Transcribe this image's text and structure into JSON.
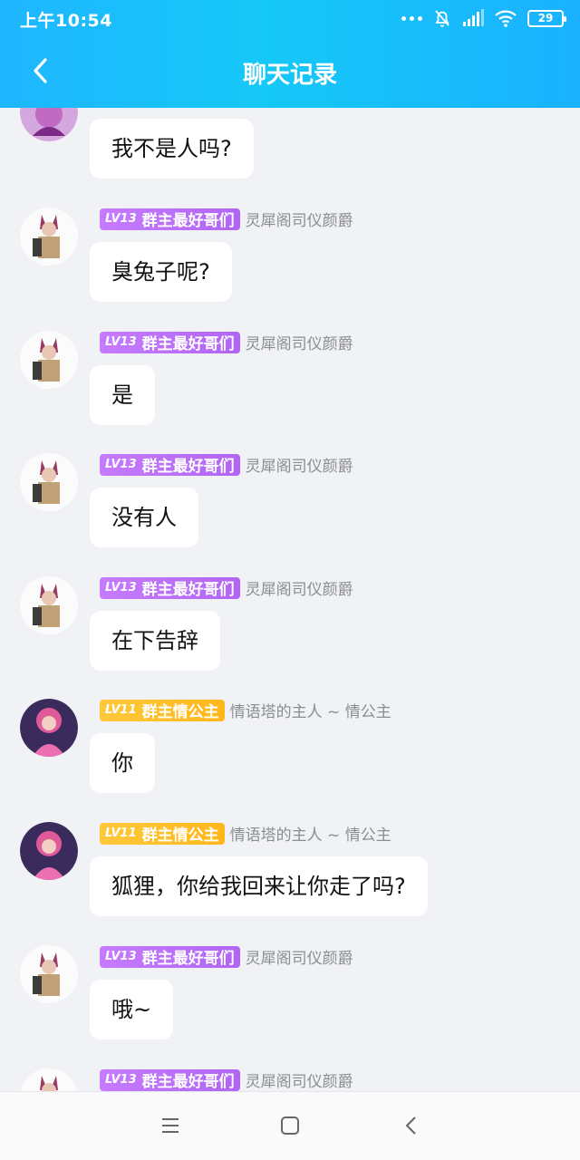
{
  "status_bar": {
    "time": "上午10:54",
    "battery": "29"
  },
  "header": {
    "title": "聊天记录"
  },
  "messages": [
    {
      "avatar": "fox-girl-avatar",
      "level": "",
      "title": "",
      "name": "",
      "text": "我不是人吗?"
    },
    {
      "avatar": "fox-girl-avatar",
      "level": "LV13",
      "title": "群主最好哥们",
      "name": "灵犀阁司仪颜爵",
      "text": "臭兔子呢?"
    },
    {
      "avatar": "fox-girl-avatar",
      "level": "LV13",
      "title": "群主最好哥们",
      "name": "灵犀阁司仪颜爵",
      "text": "是"
    },
    {
      "avatar": "fox-girl-avatar",
      "level": "LV13",
      "title": "群主最好哥们",
      "name": "灵犀阁司仪颜爵",
      "text": "没有人"
    },
    {
      "avatar": "fox-girl-avatar",
      "level": "LV13",
      "title": "群主最好哥们",
      "name": "灵犀阁司仪颜爵",
      "text": "在下告辞"
    },
    {
      "avatar": "pink-princess-avatar",
      "level": "LV11",
      "title": "群主情公主",
      "name": "情语塔的主人 ~ 情公主",
      "text": "你"
    },
    {
      "avatar": "pink-princess-avatar",
      "level": "LV11",
      "title": "群主情公主",
      "name": "情语塔的主人 ~ 情公主",
      "text": "狐狸，你给我回来让你走了吗?"
    },
    {
      "avatar": "fox-girl-avatar",
      "level": "LV13",
      "title": "群主最好哥们",
      "name": "灵犀阁司仪颜爵",
      "text": "哦~"
    },
    {
      "avatar": "fox-girl-avatar",
      "level": "LV13",
      "title": "群主最好哥们",
      "name": "灵犀阁司仪颜爵",
      "text": ""
    }
  ],
  "colors": {
    "header_gradient": "#15c8f7",
    "badge_purple": "#b066f4",
    "badge_yellow": "#ffb71a",
    "background": "#f1f2f6"
  },
  "nav_icons": [
    "menu-icon",
    "home-square-icon",
    "back-triangle-icon"
  ]
}
